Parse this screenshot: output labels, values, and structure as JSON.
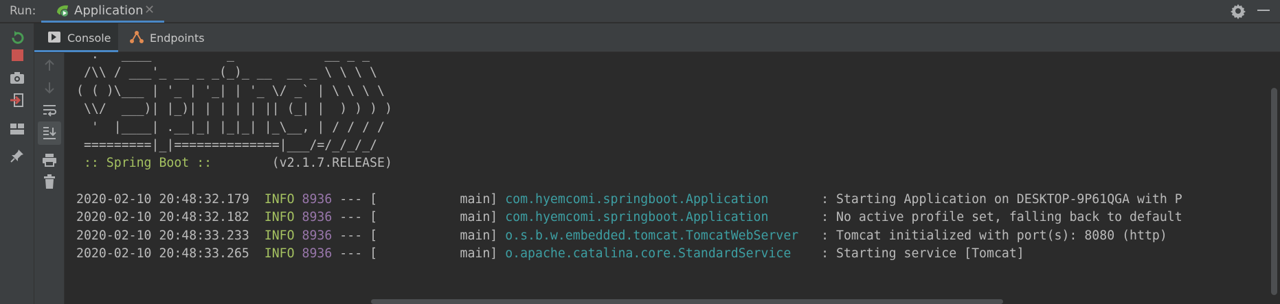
{
  "run_bar": {
    "label": "Run:",
    "tab_title": "Application",
    "close_glyph": "✕",
    "icons": [
      "spring-boot-run-icon",
      "gear-icon",
      "minimize-icon"
    ]
  },
  "sub_tabs": [
    {
      "label": "Console",
      "icon": "console-icon",
      "active": true
    },
    {
      "label": "Endpoints",
      "icon": "endpoints-icon",
      "active": false
    }
  ],
  "left_toolbar": [
    "rerun-icon",
    "stop-icon",
    "camera-icon",
    "exit-icon",
    "layout-icon",
    "pin-icon"
  ],
  "console_toolbar": [
    "arrow-up-icon",
    "arrow-down-icon",
    "soft-wrap-icon",
    "scroll-to-end-icon",
    "print-icon",
    "trash-icon"
  ],
  "console": {
    "banner": [
      "  .   ____          _            __ _ _",
      " /\\\\ / ___'_ __ _ _(_)_ __  __ _ \\ \\ \\ \\",
      "( ( )\\___ | '_ | '_| | '_ \\/ _` | \\ \\ \\ \\",
      " \\\\/  ___)| |_)| | | | | || (_| |  ) ) ) )",
      "  '  |____| .__|_| |_|_| |_\\__, | / / / /",
      " =========|_|==============|___/=/_/_/_/"
    ],
    "spring_label": " :: Spring Boot ::",
    "spring_version": "        (v2.1.7.RELEASE)",
    "logs": [
      {
        "ts": "2020-02-10 20:48:32.179",
        "level": "INFO",
        "pid": "8936",
        "sep": " --- [",
        "thread": "           main]",
        "logger": "com.hyemcomi.springboot.Application      ",
        "msg": " : Starting Application on DESKTOP-9P61QGA with P"
      },
      {
        "ts": "2020-02-10 20:48:32.182",
        "level": "INFO",
        "pid": "8936",
        "sep": " --- [",
        "thread": "           main]",
        "logger": "com.hyemcomi.springboot.Application      ",
        "msg": " : No active profile set, falling back to default"
      },
      {
        "ts": "2020-02-10 20:48:33.233",
        "level": "INFO",
        "pid": "8936",
        "sep": " --- [",
        "thread": "           main]",
        "logger": "o.s.b.w.embedded.tomcat.TomcatWebServer  ",
        "msg": " : Tomcat initialized with port(s): 8080 (http)"
      },
      {
        "ts": "2020-02-10 20:48:33.265",
        "level": "INFO",
        "pid": "8936",
        "sep": " --- [",
        "thread": "           main]",
        "logger": "o.apache.catalina.core.StandardService   ",
        "msg": " : Starting service [Tomcat]"
      }
    ]
  },
  "colors": {
    "accent": "#4a88c7",
    "info": "#a5c261",
    "pid": "#9876aa",
    "logger": "#3d9fa3",
    "stop": "#c75450",
    "rerun": "#499c54"
  }
}
